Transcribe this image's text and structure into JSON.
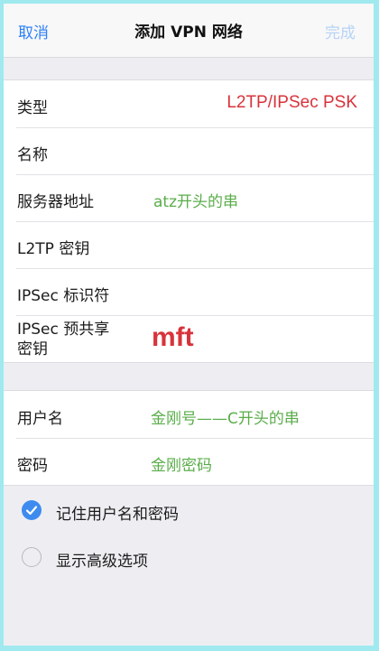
{
  "nav": {
    "cancel": "取消",
    "title": "添加 VPN 网络",
    "done": "完成"
  },
  "fields": {
    "type": {
      "label": "类型",
      "value": "L2TP/IPSec PSK"
    },
    "name": {
      "label": "名称",
      "value": ""
    },
    "server": {
      "label": "服务器地址",
      "value": "atz开头的串"
    },
    "l2tp_secret": {
      "label": "L2TP 密钥",
      "value": ""
    },
    "ipsec_id": {
      "label": "IPSec 标识符",
      "value": ""
    },
    "ipsec_psk": {
      "label_line1": "IPSec 预共享",
      "label_line2": "密钥",
      "value": "mft"
    },
    "username": {
      "label": "用户名",
      "value": "金刚号——C开头的串"
    },
    "password": {
      "label": "密码",
      "value": "金刚密码"
    }
  },
  "options": {
    "remember": {
      "label": "记住用户名和密码",
      "checked": true
    },
    "advanced": {
      "label": "显示高级选项",
      "checked": false
    }
  },
  "colors": {
    "accent": "#3e8bf0",
    "link": "#2d7ff9",
    "annotation_red": "#d8333b",
    "annotation_green": "#5aad4a"
  },
  "icons": {
    "checked": "checkmark-icon"
  }
}
